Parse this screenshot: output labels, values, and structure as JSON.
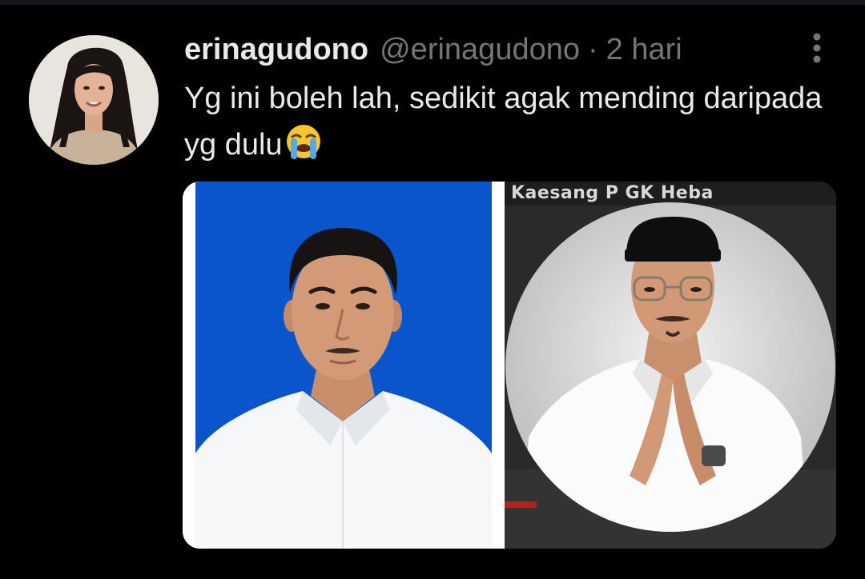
{
  "tweet": {
    "display_name": "erinagudono",
    "handle": "@erinagudono",
    "separator": "·",
    "time": "2 hari",
    "text": "Yg ini boleh lah, sedikit agak mending daripada yg dulu",
    "emoji_icon": "loudly-crying-face-icon"
  },
  "media": {
    "left_photo": "portrait-photo-blue-background",
    "right_photo": "portrait-photo-circle-frame",
    "right_caption": "Kaesang P          GK Heba"
  },
  "colors": {
    "background": "#000000",
    "primary_text": "#e7e9ea",
    "secondary_text": "#71767b",
    "photo_blue": "#0a55cc"
  }
}
